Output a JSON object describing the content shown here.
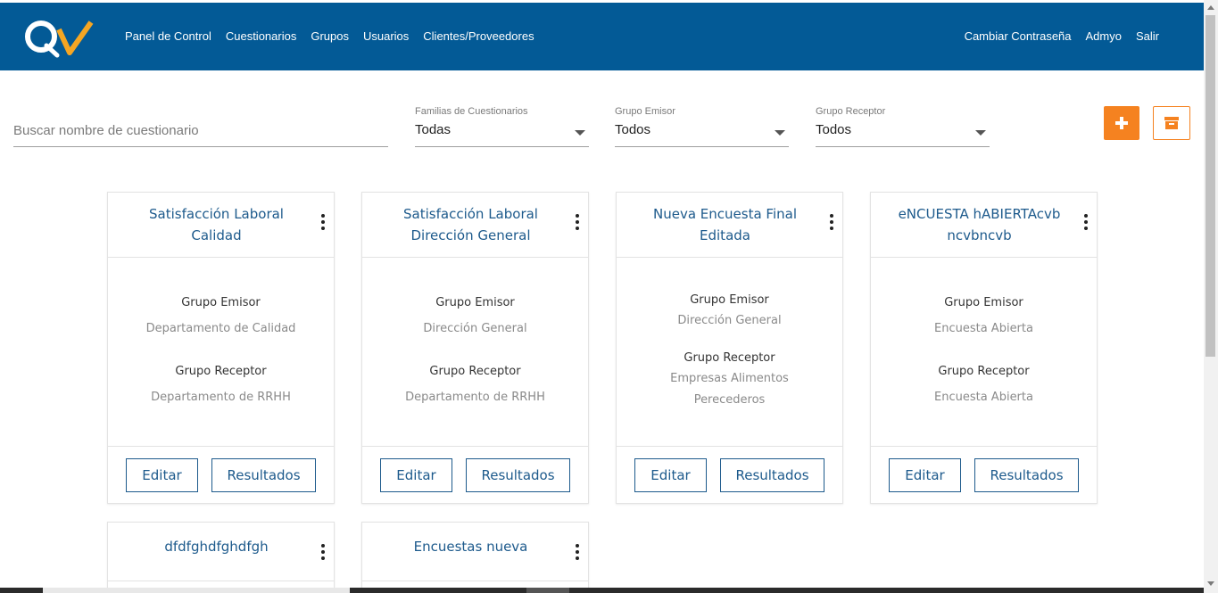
{
  "nav": {
    "logo_text": "QV",
    "left": [
      "Panel de Control",
      "Cuestionarios",
      "Grupos",
      "Usuarios",
      "Clientes/Proveedores"
    ],
    "right": [
      "Cambiar Contraseña",
      "Admyo",
      "Salir"
    ]
  },
  "filters": {
    "search_placeholder": "Buscar nombre de cuestionario",
    "familias": {
      "label": "Familias de Cuestionarios",
      "value": "Todas"
    },
    "emisor": {
      "label": "Grupo Emisor",
      "value": "Todos"
    },
    "receptor": {
      "label": "Grupo Receptor",
      "value": "Todos"
    },
    "add_icon": "plus-icon",
    "archive_icon": "archive-icon"
  },
  "labels": {
    "emisor": "Grupo Emisor",
    "receptor": "Grupo Receptor",
    "edit": "Editar",
    "results": "Resultados"
  },
  "cards": [
    {
      "title": "Satisfacción Laboral Calidad",
      "emisor": "Departamento de Calidad",
      "receptor": "Departamento de RRHH"
    },
    {
      "title": "Satisfacción Laboral Dirección General",
      "emisor": "Dirección General",
      "receptor": "Departamento de RRHH"
    },
    {
      "title": "Nueva Encuesta Final Editada",
      "emisor": "Dirección General",
      "receptor": "Empresas Alimentos Perecederos"
    },
    {
      "title": "eNCUESTA hABIERTAcvbncvbncvb",
      "emisor": "Encuesta Abierta",
      "receptor": "Encuesta Abierta"
    },
    {
      "title": "dfdfghdfghdfgh"
    },
    {
      "title": "Encuestas nueva"
    }
  ],
  "colors": {
    "navbar": "#035a96",
    "accent": "#f58220",
    "card_text": "#1d5a8c"
  }
}
